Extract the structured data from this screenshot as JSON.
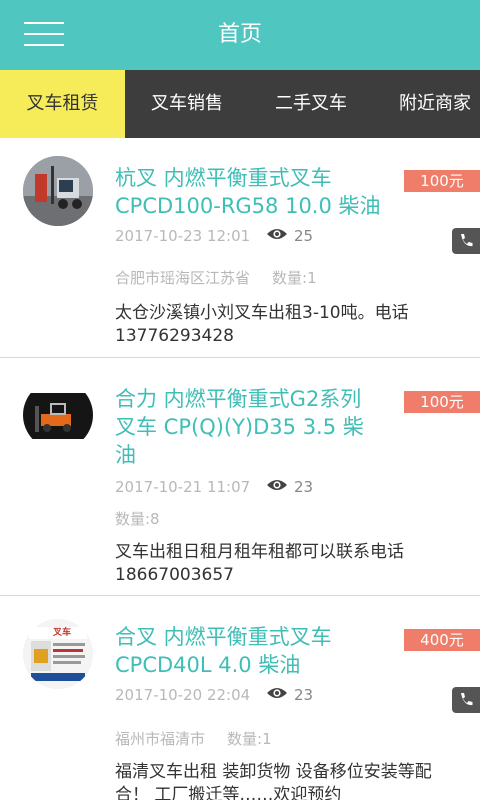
{
  "header": {
    "title": "首页",
    "menu_icon": "hamburger-menu-icon"
  },
  "tabs": [
    {
      "label": "叉车租赁",
      "active": true
    },
    {
      "label": "叉车销售",
      "active": false
    },
    {
      "label": "二手叉车",
      "active": false
    },
    {
      "label": "附近商家",
      "active": false
    }
  ],
  "colors": {
    "header_bg": "#4fc6bf",
    "tabbar_bg": "#3d3d3d",
    "active_tab_bg": "#f6ec5a",
    "title": "#3fbeb6",
    "price_bg": "#f07d6a"
  },
  "listings": [
    {
      "title_line1": "杭叉 内燃平衡重式叉车",
      "title_line2": "CPCD100-RG58 10.0 柴油",
      "title_line3": "",
      "price": "100元",
      "date": "2017-10-23 12:01",
      "views": "25",
      "location": "合肥市瑶海区江苏省",
      "quantity": "数量:1",
      "desc_line1": "太仓沙溪镇小刘叉车出租3-10吨。电话",
      "desc_line2": "13776293428",
      "thumb_text": ""
    },
    {
      "title_line1": "合力 内燃平衡重式G2系列",
      "title_line2": "叉车 CP(Q)(Y)D35 3.5 柴",
      "title_line3": "油",
      "price": "100元",
      "date": "2017-10-21 11:07",
      "views": "23",
      "location": "",
      "quantity": "数量:8",
      "desc_line1": "叉车出租日租月租年租都可以联系电话",
      "desc_line2": "18667003657",
      "thumb_text": ""
    },
    {
      "title_line1": "合叉 内燃平衡重式叉车",
      "title_line2": "CPCD40L 4.0 柴油",
      "title_line3": "",
      "price": "400元",
      "date": "2017-10-20 22:04",
      "views": "23",
      "location": "福州市福清市",
      "quantity": "数量:1",
      "desc_line1": "福清叉车出租 装卸货物 设备移位安装等配",
      "desc_line2": "合！ 工厂搬迁等……欢迎预约",
      "thumb_text": "叉车"
    }
  ]
}
